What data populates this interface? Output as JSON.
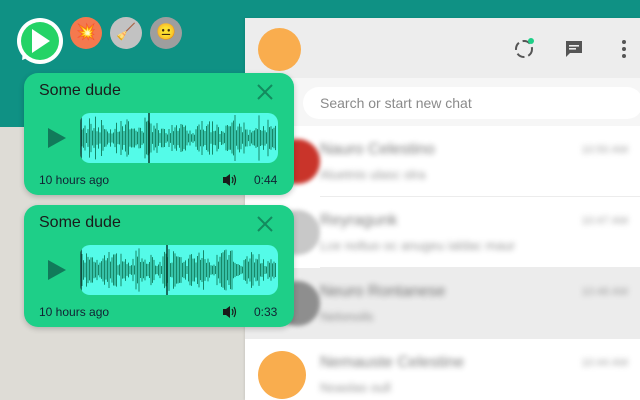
{
  "colors": {
    "teal_header": "#0f9184",
    "card_green": "#1ecf88",
    "waveform_bg": "#54fbe8",
    "waveform_stroke": "#117a5a",
    "avatar_orange": "#f9ad4e"
  },
  "extension": {
    "logo_icon": "whatsapp-play-logo",
    "buttons": [
      {
        "icon": "burst-icon",
        "glyph": "💥"
      },
      {
        "icon": "broom-icon",
        "glyph": "🧹"
      },
      {
        "icon": "face-icon",
        "glyph": "😐"
      }
    ]
  },
  "voice_messages": [
    {
      "sender": "Some dude",
      "time_ago": "10 hours ago",
      "duration": "0:44",
      "progress": 0.35
    },
    {
      "sender": "Some dude",
      "time_ago": "10 hours ago",
      "duration": "0:33",
      "progress": 0.44
    }
  ],
  "whatsapp": {
    "header_icons": [
      "status-icon",
      "new-chat-icon",
      "menu-icon"
    ],
    "search_placeholder": "Search or start new chat",
    "chats": [
      {
        "name": "Nauro Celestino",
        "message": "Aluetnis ulasc olra",
        "time": "10:50 AM",
        "selected": false
      },
      {
        "name": "Reyragunk",
        "message": "Lce noltuo oc anugeu ialdac maur",
        "time": "10:47 AM",
        "selected": false
      },
      {
        "name": "Neuro Rontanese",
        "message": "Nelonoils",
        "time": "10:48 AM",
        "selected": true
      },
      {
        "name": "Nemauste Celestine",
        "message": "Noaslas oull",
        "time": "10:44 AM",
        "selected": false
      }
    ]
  }
}
